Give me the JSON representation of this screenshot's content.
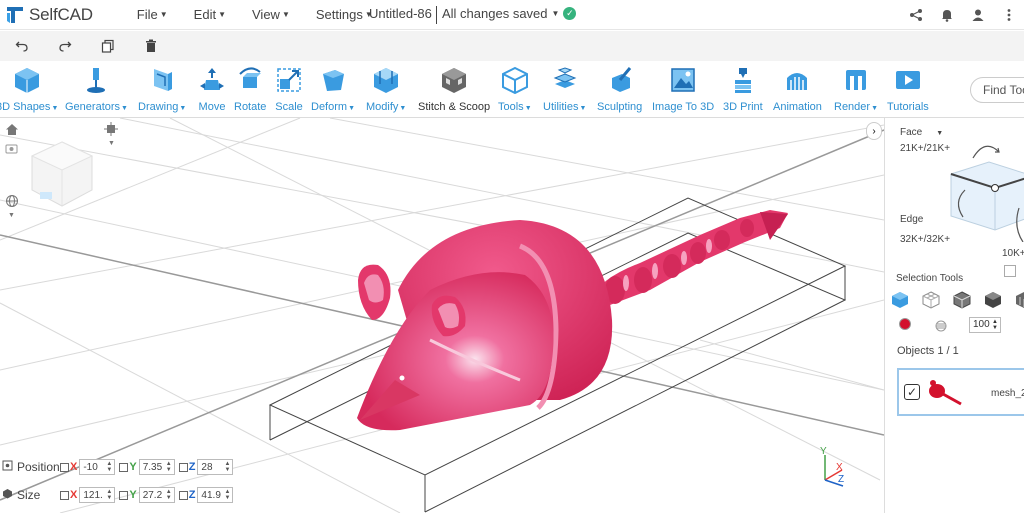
{
  "app": {
    "name": "SelfCAD",
    "document_title": "Untitled-86",
    "save_status": "All changes saved"
  },
  "menu": [
    {
      "label": "File"
    },
    {
      "label": "Edit"
    },
    {
      "label": "View"
    },
    {
      "label": "Settings"
    }
  ],
  "tools": [
    {
      "label": "3D Shapes",
      "icon": "cube-icon",
      "has_menu": true
    },
    {
      "label": "Generators",
      "icon": "pin-icon",
      "has_menu": true
    },
    {
      "label": "Drawing",
      "icon": "drawing-icon",
      "has_menu": true
    },
    {
      "label": "Move",
      "icon": "move-icon",
      "has_menu": false
    },
    {
      "label": "Rotate",
      "icon": "rotate-icon",
      "has_menu": false
    },
    {
      "label": "Scale",
      "icon": "scale-icon",
      "has_menu": false
    },
    {
      "label": "Deform",
      "icon": "deform-icon",
      "has_menu": true
    },
    {
      "label": "Modify",
      "icon": "modify-icon",
      "has_menu": true
    },
    {
      "label": "Stitch & Scoop",
      "icon": "stitch-scoop-icon",
      "has_menu": false
    },
    {
      "label": "Tools",
      "icon": "tools-icon",
      "has_menu": true
    },
    {
      "label": "Utilities",
      "icon": "utilities-icon",
      "has_menu": true
    },
    {
      "label": "Sculpting",
      "icon": "sculpting-icon",
      "has_menu": false
    },
    {
      "label": "Image To 3D",
      "icon": "image-to-3d-icon",
      "has_menu": false
    },
    {
      "label": "3D Print",
      "icon": "3d-print-icon",
      "has_menu": false
    },
    {
      "label": "Animation",
      "icon": "animation-icon",
      "has_menu": false
    },
    {
      "label": "Render",
      "icon": "render-icon",
      "has_menu": true
    },
    {
      "label": "Tutorials",
      "icon": "tutorials-icon",
      "has_menu": false
    }
  ],
  "find_tools": {
    "placeholder": "Find Too"
  },
  "transform": {
    "position_label": "Position",
    "size_label": "Size",
    "position": {
      "x": "-10",
      "y": "7.35",
      "z": "28"
    },
    "size": {
      "x": "121.",
      "y": "27.2",
      "z": "41.9"
    }
  },
  "axis_gizmo": {
    "x": "X",
    "y": "Y",
    "z": "Z"
  },
  "right_panel": {
    "face_label": "Face",
    "face_count": "21K+/21K+",
    "edge_label": "Edge",
    "edge_count": "32K+/32K+",
    "vertex_count": "10K+",
    "selection_tools_label": "Selection Tools",
    "opacity_value": "100",
    "objects_label": "Objects 1 / 1",
    "object_name": "mesh_2"
  },
  "colors": {
    "accent": "#2e8fd0",
    "model": "#e8346a",
    "selection_color": "#d3112d",
    "check_badge": "#36b37e"
  }
}
